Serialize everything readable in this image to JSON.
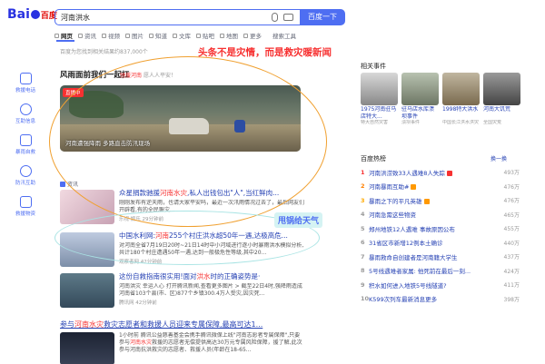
{
  "header": {
    "logo_left": "Bai",
    "logo_right": "百度",
    "query": "河南洪水",
    "search_button": "百度一下"
  },
  "tabs": [
    {
      "label": "网页",
      "active": true
    },
    {
      "label": "资讯"
    },
    {
      "label": "视频"
    },
    {
      "label": "图片"
    },
    {
      "label": "知道"
    },
    {
      "label": "文库"
    },
    {
      "label": "贴吧"
    },
    {
      "label": "地图"
    },
    {
      "label": "更多"
    }
  ],
  "tools": "搜索工具",
  "result_count": "百度为您找到相关结果约837,000个",
  "sidenav": [
    "救援电话",
    "互助信息",
    "暴雨自救",
    "防汛互助",
    "救援物资"
  ],
  "section": {
    "title": "风雨面前我们一起扛",
    "subtitle_prefix": "驰援河南",
    "subtitle_suffix": "愿人人平安！"
  },
  "hero": {
    "badge": "直播中",
    "caption": "河南遭强降雨 多路直击防汛现场"
  },
  "annotations": {
    "top": "头条不是灾情，而是救灾暖新闻",
    "mid": "甩锅给天气"
  },
  "source_row": "资讯",
  "news": [
    {
      "title_pre": "众星捐款驰援",
      "title_hl": "河南水灾",
      "title_post": ",私人出钱包出\"人\",当红鲜肉...",
      "desc": "刚刚发布有逆天雨，也请大家平安吗，最近一次汛雨情况过去了，最后网友们开辟看,有的全民赈灾...",
      "meta": "乐视·娱乐 29分钟前"
    },
    {
      "title_pre": "中国水利网:",
      "title_hl": "河南",
      "title_post": "255个村庄洪水超50年一遇,达极高危...",
      "desc": "对河南全省7月19日20时~21日14时中小河域进行逐小时暴雨洪水模拟分析,共计180个村庄遭遇50年一遇,达到一般极危性等级,其中20...",
      "meta": "观察者网 42分钟前"
    },
    {
      "title_pre": "这份自救指南很实用!面对",
      "title_hl": "洪水",
      "title_post": "时的正确姿势是·",
      "desc": "河南洪灾 幸运人心 打开腾讯新闻,查看更多图片 > 截至22日4时,强降雨造成河南省103个县(市、区)877个乡镇300.4万人受灾,因灾死...",
      "meta": "腾讯网 42分钟前"
    }
  ],
  "wide_news": {
    "title_pre": "参与",
    "title_hl": "河南水灾",
    "title_post": "救灾志愿者和救援人员迎来专属保障,最高可达1...",
    "desc_pre": "1小时前 腾讯公益慈善基金会携手腾讯微保上线\"河南志愿者专属保障\",只要参与",
    "desc_hl": "河南水灾",
    "desc_post": "救援的志愿者无偿提供高达30万元专属风险保障，援了解,此次参与河南抗洪救灾的志愿者、救援人员(年龄在18-65..."
  },
  "related": {
    "title": "相关事件",
    "items": [
      {
        "caption": "1975河南驻马店特大...",
        "sub": "特大自然灾害"
      },
      {
        "caption": "驻马店水库溃坝事件",
        "sub": "溃坝事件"
      },
      {
        "caption": "1998特大洪水",
        "sub": "中国长江洪水洪灾"
      },
      {
        "caption": "河南大饥荒",
        "sub": "全国灾荒"
      }
    ]
  },
  "hot": {
    "title": "百度热榜",
    "refresh": "换一换",
    "items": [
      {
        "rank": "1",
        "text": "河南洪涝致33人遇难8人失踪",
        "count": "493万",
        "tag": "#f73131"
      },
      {
        "rank": "2",
        "text": "河南暴雨互助#",
        "count": "476万",
        "tag": "#ff9900"
      },
      {
        "rank": "3",
        "text": "暴雨之下的平凡英雄",
        "count": "476万",
        "tag": "#ff9900"
      },
      {
        "rank": "4",
        "text": "河南急需这些物资",
        "count": "465万",
        "tag": ""
      },
      {
        "rank": "5",
        "text": "郑州地铁12人遇难 事故原因公布",
        "count": "455万",
        "tag": ""
      },
      {
        "rank": "6",
        "text": "31省区市新增12例本土确诊",
        "count": "440万",
        "tag": ""
      },
      {
        "rank": "7",
        "text": "暴雨救命自创建者是河南籍大学生",
        "count": "437万",
        "tag": ""
      },
      {
        "rank": "8",
        "text": "5号线遇难者家属: 他死前在最后一刻...",
        "count": "424万",
        "tag": ""
      },
      {
        "rank": "9",
        "text": "积水如何进入地铁5号线隧道?",
        "count": "411万",
        "tag": ""
      },
      {
        "rank": "10",
        "text": "K599次列车最新消息更多",
        "count": "398万",
        "tag": ""
      }
    ]
  }
}
